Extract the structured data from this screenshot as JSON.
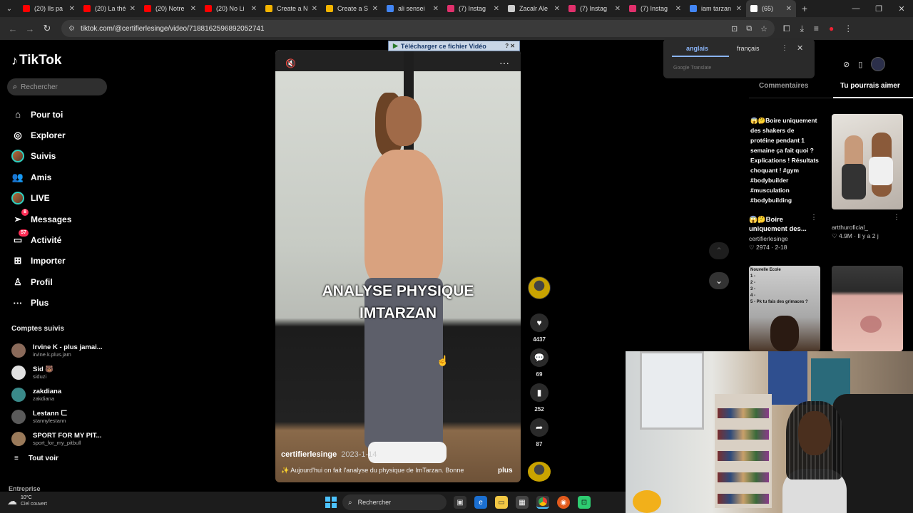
{
  "browser": {
    "tabs": [
      {
        "title": "(20) Ils pa",
        "color": "#ff0000"
      },
      {
        "title": "(20) La thé",
        "color": "#ff0000"
      },
      {
        "title": "(20) Notre",
        "color": "#ff0000"
      },
      {
        "title": "(20) No Li",
        "color": "#ff0000"
      },
      {
        "title": "Create a N",
        "color": "#f4b400"
      },
      {
        "title": "Create a S",
        "color": "#f4b400"
      },
      {
        "title": "ali sensei",
        "color": "#4285f4"
      },
      {
        "title": "(7) Instag",
        "color": "#e1306c"
      },
      {
        "title": "Zacalr Ale",
        "color": "#cccccc"
      },
      {
        "title": "(7) Instag",
        "color": "#e1306c"
      },
      {
        "title": "(7) Instag",
        "color": "#e1306c"
      },
      {
        "title": "iam tarzan",
        "color": "#4285f4"
      },
      {
        "title": "(65)",
        "color": "#ffffff"
      }
    ],
    "url": "tiktok.com/@certifierlesinge/video/7188162596892052741"
  },
  "tiktok": {
    "logo": "TikTok",
    "search_placeholder": "Rechercher",
    "nav": [
      {
        "label": "Pour toi",
        "icon": "home-icon",
        "glyph": "⌂"
      },
      {
        "label": "Explorer",
        "icon": "compass-icon",
        "glyph": "◎"
      },
      {
        "label": "Suivis",
        "icon": "avatar-icon",
        "glyph": ""
      },
      {
        "label": "Amis",
        "icon": "friends-icon",
        "glyph": "👥"
      },
      {
        "label": "LIVE",
        "icon": "live-icon",
        "glyph": ""
      },
      {
        "label": "Messages",
        "icon": "messages-icon",
        "glyph": "➢",
        "badge": "8"
      },
      {
        "label": "Activité",
        "icon": "activity-icon",
        "glyph": "▭",
        "badge": "57"
      },
      {
        "label": "Importer",
        "icon": "upload-icon",
        "glyph": "⊞"
      },
      {
        "label": "Profil",
        "icon": "profile-icon",
        "glyph": "♙"
      },
      {
        "label": "Plus",
        "icon": "more-icon",
        "glyph": "···"
      }
    ],
    "following_title": "Comptes suivis",
    "following": [
      {
        "name": "Irvine K - plus jamai...",
        "handle": "irvine.k.plus.jam",
        "color": "#8a6a5a"
      },
      {
        "name": "Sid 🐻",
        "handle": "siduzi",
        "color": "#e0e0e0"
      },
      {
        "name": "zakdiana",
        "handle": "zakdiana",
        "color": "#3a8a8a"
      },
      {
        "name": "Lestann ㄈ",
        "handle": "stannylestann",
        "color": "#5a5a5a"
      },
      {
        "name": "SPORT FOR MY PIT...",
        "handle": "sport_for_my_pitbull",
        "color": "#9a7a5a"
      }
    ],
    "see_all": "Tout voir",
    "enterprise": "Entreprise"
  },
  "video": {
    "download_label": "Télécharger ce fichier Vidéo",
    "overlay_line1": "ANALYSE PHYSIQUE",
    "overlay_line2": "IMTARZAN",
    "author": "certifierlesinge",
    "date": "2023-1-14",
    "caption": "Aujourd'hui on fait l'analyse du physique de ImTarzan. Bonne",
    "more": "plus",
    "likes": "4437",
    "comments": "69",
    "saves": "252",
    "shares": "87"
  },
  "translate": {
    "lang_source": "anglais",
    "lang_target": "français",
    "brand": "Google Translate"
  },
  "right_panel": {
    "tab_comments": "Commentaires",
    "tab_recommended": "Tu pourrais aimer",
    "cards": [
      {
        "thumb_text": "😱🤔Boire uniquement des shakers de protéine pendant 1 semaine ça fait quoi ? Explications ! Résultats choquant ! #gym #bodybuilder #musculation #bodybuilding",
        "title": "😱🤔Boire uniquement des...",
        "author": "certifierlesinge",
        "stats": "♡ 2974 · 2-18"
      },
      {
        "thumb_text": "",
        "title": "",
        "author": "artthuroficial_",
        "stats": "♡ 4.9M · Il y a 2 j"
      },
      {
        "thumb_text": "Nouvelle Ecole\n1 -\n2 -\n3 -\n4 -\n5 - Pk tu fais des grimaces ?",
        "title": "",
        "author": "",
        "stats": ""
      },
      {
        "thumb_text": "",
        "title": "",
        "author": "",
        "stats": ""
      }
    ]
  },
  "taskbar": {
    "temp": "10°C",
    "weather": "Ciel couvert",
    "search": "Rechercher"
  }
}
